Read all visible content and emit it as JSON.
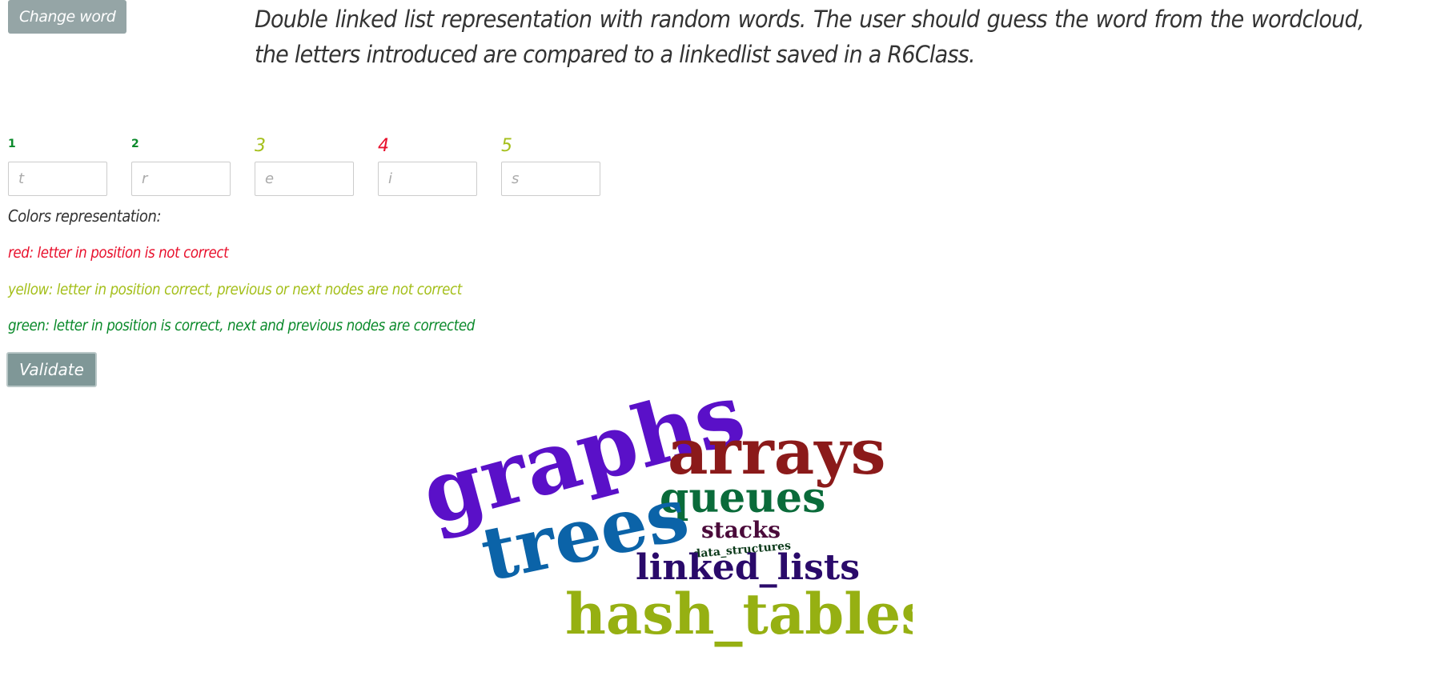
{
  "header": {
    "change_word_label": "Change word",
    "description": "Double linked list representation with random words. The user should guess the word from the wordcloud, the letters introduced are compared to a linkedlist saved in a R6Class."
  },
  "positions": [
    {
      "label": "1",
      "placeholder": "t",
      "color": "#0b8a2b"
    },
    {
      "label": "2",
      "placeholder": "r",
      "color": "#0b8a2b"
    },
    {
      "label": "3",
      "placeholder": "e",
      "color": "#a4bf1a"
    },
    {
      "label": "4",
      "placeholder": "i",
      "color": "#e8112d"
    },
    {
      "label": "5",
      "placeholder": "s",
      "color": "#a4bf1a"
    }
  ],
  "legend": {
    "title": "Colors representation:",
    "red": {
      "text": "red: letter in position is not correct",
      "color": "#e8112d"
    },
    "yellow": {
      "text": "yellow: letter in position correct, previous or next nodes are not correct",
      "color": "#a4bf1a"
    },
    "green": {
      "text": "green: letter in position is correct, next and previous nodes are corrected",
      "color": "#0b8a2b"
    }
  },
  "validate_label": "Validate",
  "wordcloud": {
    "words": [
      {
        "text": "graphs",
        "color": "#5a10c8"
      },
      {
        "text": "arrays",
        "color": "#8b1a1a"
      },
      {
        "text": "queues",
        "color": "#0a6b3a"
      },
      {
        "text": "trees",
        "color": "#0b63a8"
      },
      {
        "text": "stacks",
        "color": "#4a0a3a"
      },
      {
        "text": "data_structures",
        "color": "#0b3a1a"
      },
      {
        "text": "linked_lists",
        "color": "#2a0a6a"
      },
      {
        "text": "hash_tables",
        "color": "#96b012"
      }
    ]
  }
}
